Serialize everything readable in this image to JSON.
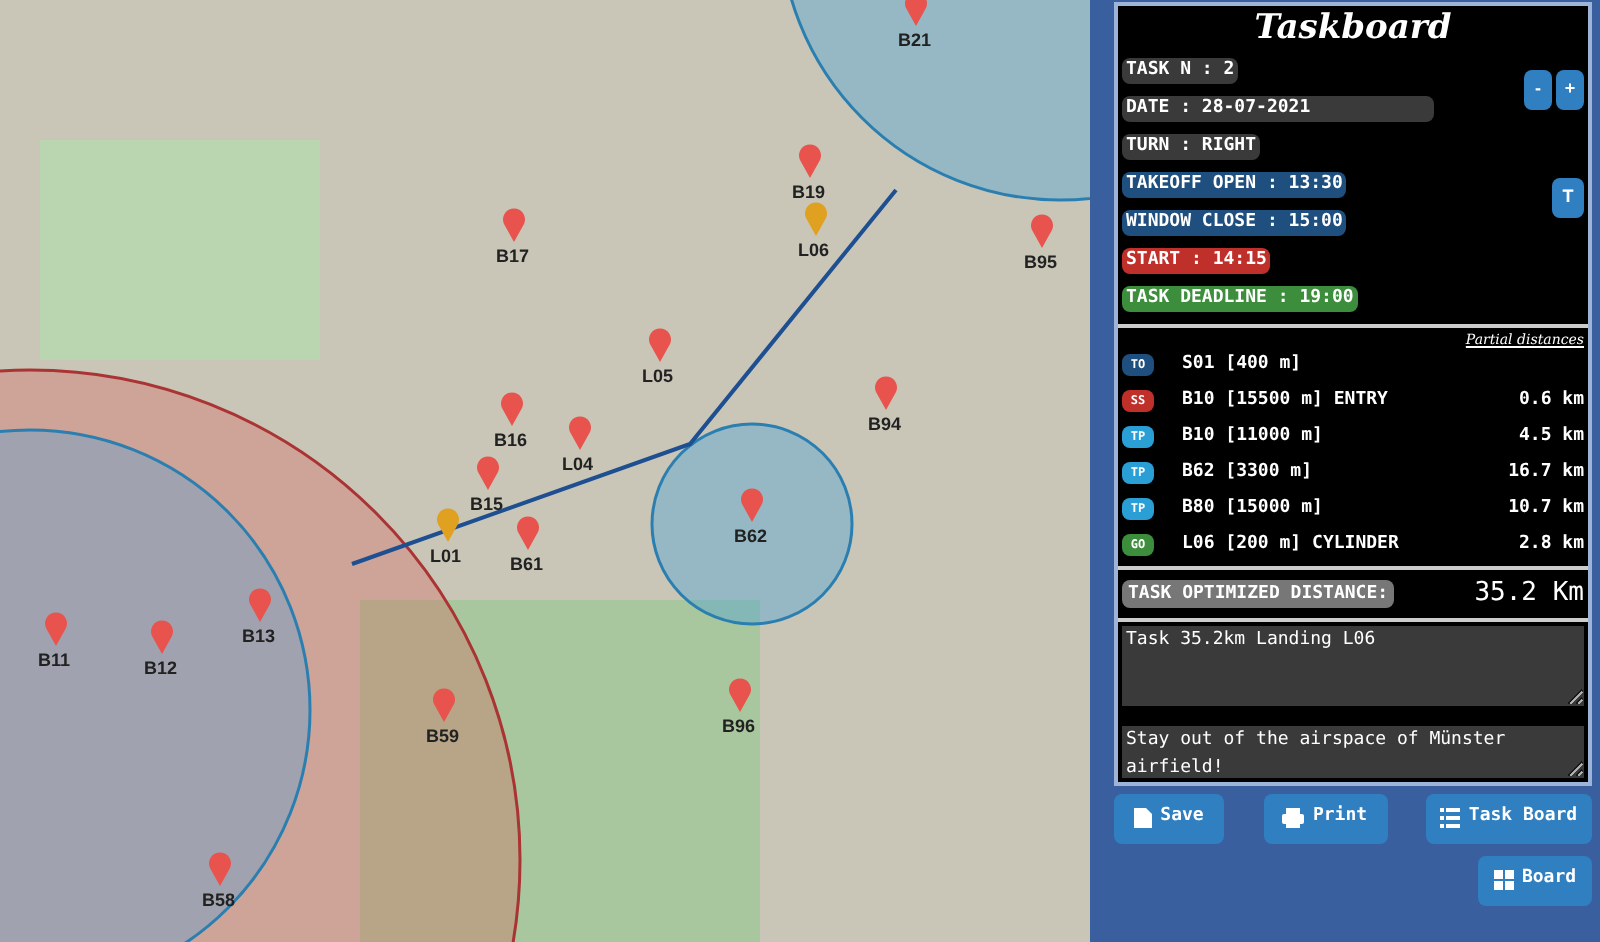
{
  "map": {
    "waypoints": [
      {
        "label": "B21",
        "kind": "turnpoint"
      },
      {
        "label": "B17",
        "kind": "turnpoint"
      },
      {
        "label": "B19",
        "kind": "turnpoint"
      },
      {
        "label": "L06",
        "kind": "landing"
      },
      {
        "label": "B95",
        "kind": "turnpoint"
      },
      {
        "label": "L05",
        "kind": "turnpoint"
      },
      {
        "label": "B16",
        "kind": "turnpoint"
      },
      {
        "label": "B94",
        "kind": "turnpoint"
      },
      {
        "label": "L04",
        "kind": "turnpoint"
      },
      {
        "label": "B15",
        "kind": "turnpoint"
      },
      {
        "label": "L01",
        "kind": "landing"
      },
      {
        "label": "B61",
        "kind": "turnpoint"
      },
      {
        "label": "B62",
        "kind": "turnpoint"
      },
      {
        "label": "B11",
        "kind": "turnpoint"
      },
      {
        "label": "B12",
        "kind": "turnpoint"
      },
      {
        "label": "B13",
        "kind": "turnpoint"
      },
      {
        "label": "B59",
        "kind": "turnpoint"
      },
      {
        "label": "B96",
        "kind": "turnpoint"
      },
      {
        "label": "B58",
        "kind": "turnpoint"
      }
    ]
  },
  "taskboard": {
    "title": "Taskboard",
    "fields": [
      {
        "text": "TASK N : 2",
        "kind": "plain"
      },
      {
        "text": "DATE : 28-07-2021",
        "kind": "plain"
      },
      {
        "text": "TURN : RIGHT",
        "kind": "plain"
      },
      {
        "text": "TAKEOFF OPEN : 13:30",
        "kind": "window"
      },
      {
        "text": "WINDOW CLOSE : 15:00",
        "kind": "window"
      },
      {
        "text": "START : 14:15",
        "kind": "start"
      },
      {
        "text": "TASK DEADLINE : 19:00",
        "kind": "deadline"
      }
    ],
    "task_buttons": [
      "-",
      "+"
    ],
    "turn_button": "T",
    "partial_distances_heading": "Partial distances",
    "legs": [
      {
        "type": "TO",
        "point": "S01 [400 m]"
      },
      {
        "type": "SS",
        "point": "B10 [15500 m] ENTRY",
        "distance": "0.6 km"
      },
      {
        "type": "TP",
        "point": "B10 [11000 m]",
        "distance": "4.5 km"
      },
      {
        "type": "TP",
        "point": "B62 [3300 m]",
        "distance": "16.7 km"
      },
      {
        "type": "TP",
        "point": "B80 [15000 m]",
        "distance": "10.7 km"
      },
      {
        "type": "GO",
        "point": "L06 [200 m] CYLINDER",
        "distance": "2.8 km"
      }
    ],
    "optimized_label": "TASK OPTIMIZED DISTANCE:",
    "optimized_value": "35.2 Km",
    "notes": [
      "Task 35.2km Landing L06",
      "Stay out of the airspace of Münster airfield!"
    ]
  },
  "buttons": [
    "Save",
    "Print",
    "Task Board",
    "Board"
  ]
}
